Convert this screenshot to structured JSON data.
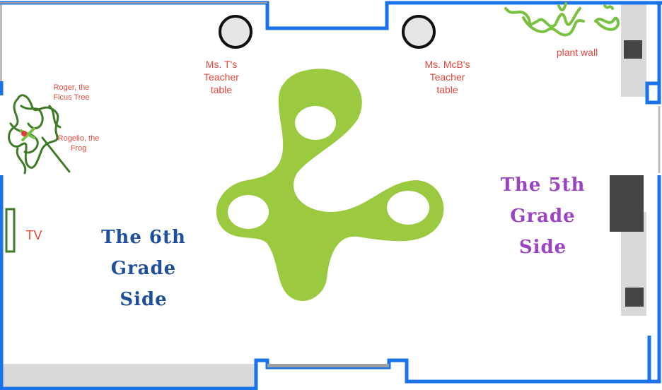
{
  "labels": {
    "teacher_t": "Ms. T's\nTeacher\ntable",
    "teacher_mcb": "Ms. McB's\nTeacher\ntable",
    "plant_wall": "plant wall",
    "ficus": "Roger, the\nFicus Tree",
    "frog": "Rogelio, the\nFrog",
    "tv": "TV",
    "sixth_side": "The 6th\nGrade\nSide",
    "fifth_side": "The 5th\nGrade\nSide"
  },
  "colors": {
    "wall_blue": "#1a73e8",
    "table_green": "#9bc93f",
    "label_red": "#e4473c",
    "sixth_blue": "#1f4e9a",
    "fifth_purple": "#9b45c4",
    "plant_green": "#7ac142",
    "ficus_green": "#3f7a26",
    "cabinet_gray": "#444444",
    "panel_gray": "#d9d9d9"
  }
}
